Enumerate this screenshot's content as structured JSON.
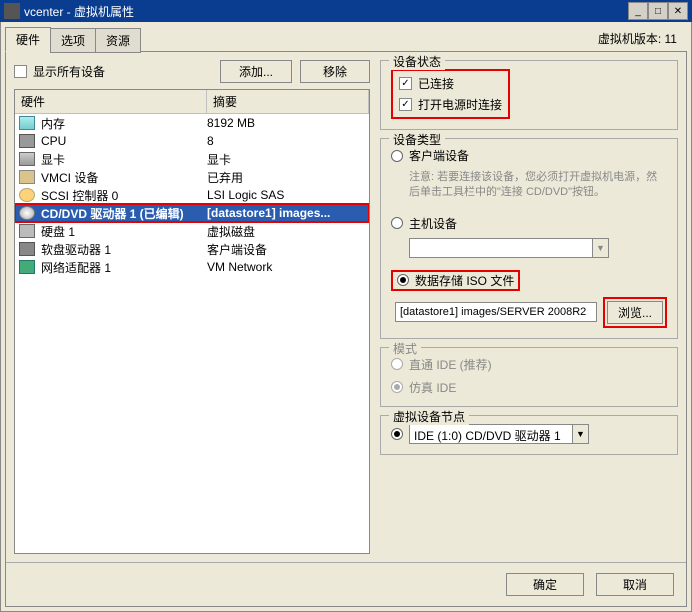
{
  "window": {
    "title": "vcenter - 虚拟机属性",
    "version": "虚拟机版本: 11"
  },
  "tabs": [
    "硬件",
    "选项",
    "资源"
  ],
  "showAllDevices": "显示所有设备",
  "buttons": {
    "add": "添加...",
    "remove": "移除"
  },
  "columns": {
    "hardware": "硬件",
    "summary": "摘要"
  },
  "hardware": [
    {
      "icon": "ic-mem",
      "name": "内存",
      "summary": "8192 MB"
    },
    {
      "icon": "ic-cpu",
      "name": "CPU",
      "summary": "8"
    },
    {
      "icon": "ic-video",
      "name": "显卡",
      "summary": "显卡"
    },
    {
      "icon": "ic-vmci",
      "name": "VMCI 设备",
      "summary": "已弃用"
    },
    {
      "icon": "ic-scsi",
      "name": "SCSI 控制器 0",
      "summary": "LSI Logic SAS"
    },
    {
      "icon": "ic-cd",
      "name": "CD/DVD 驱动器 1 (已编辑)",
      "summary": "[datastore1] images..."
    },
    {
      "icon": "ic-hd",
      "name": "硬盘 1",
      "summary": "虚拟磁盘"
    },
    {
      "icon": "ic-floppy",
      "name": "软盘驱动器 1",
      "summary": "客户端设备"
    },
    {
      "icon": "ic-nic",
      "name": "网络适配器 1",
      "summary": "VM Network"
    }
  ],
  "deviceStatus": {
    "title": "设备状态",
    "connected": "已连接",
    "connectAtPowerOn": "打开电源时连接"
  },
  "deviceType": {
    "title": "设备类型",
    "clientDevice": "客户端设备",
    "clientNote": "注意: 若要连接该设备，您必须打开虚拟机电源，然后单击工具栏中的\"连接 CD/DVD\"按钮。",
    "hostDevice": "主机设备",
    "isoFile": "数据存储 ISO 文件",
    "isoPath": "[datastore1] images/SERVER 2008R2",
    "browse": "浏览..."
  },
  "mode": {
    "title": "模式",
    "passthrough": "直通 IDE (推荐)",
    "emulate": "仿真 IDE"
  },
  "virtualDeviceNode": {
    "title": "虚拟设备节点",
    "value": "IDE (1:0) CD/DVD 驱动器 1"
  },
  "footer": {
    "ok": "确定",
    "cancel": "取消"
  }
}
